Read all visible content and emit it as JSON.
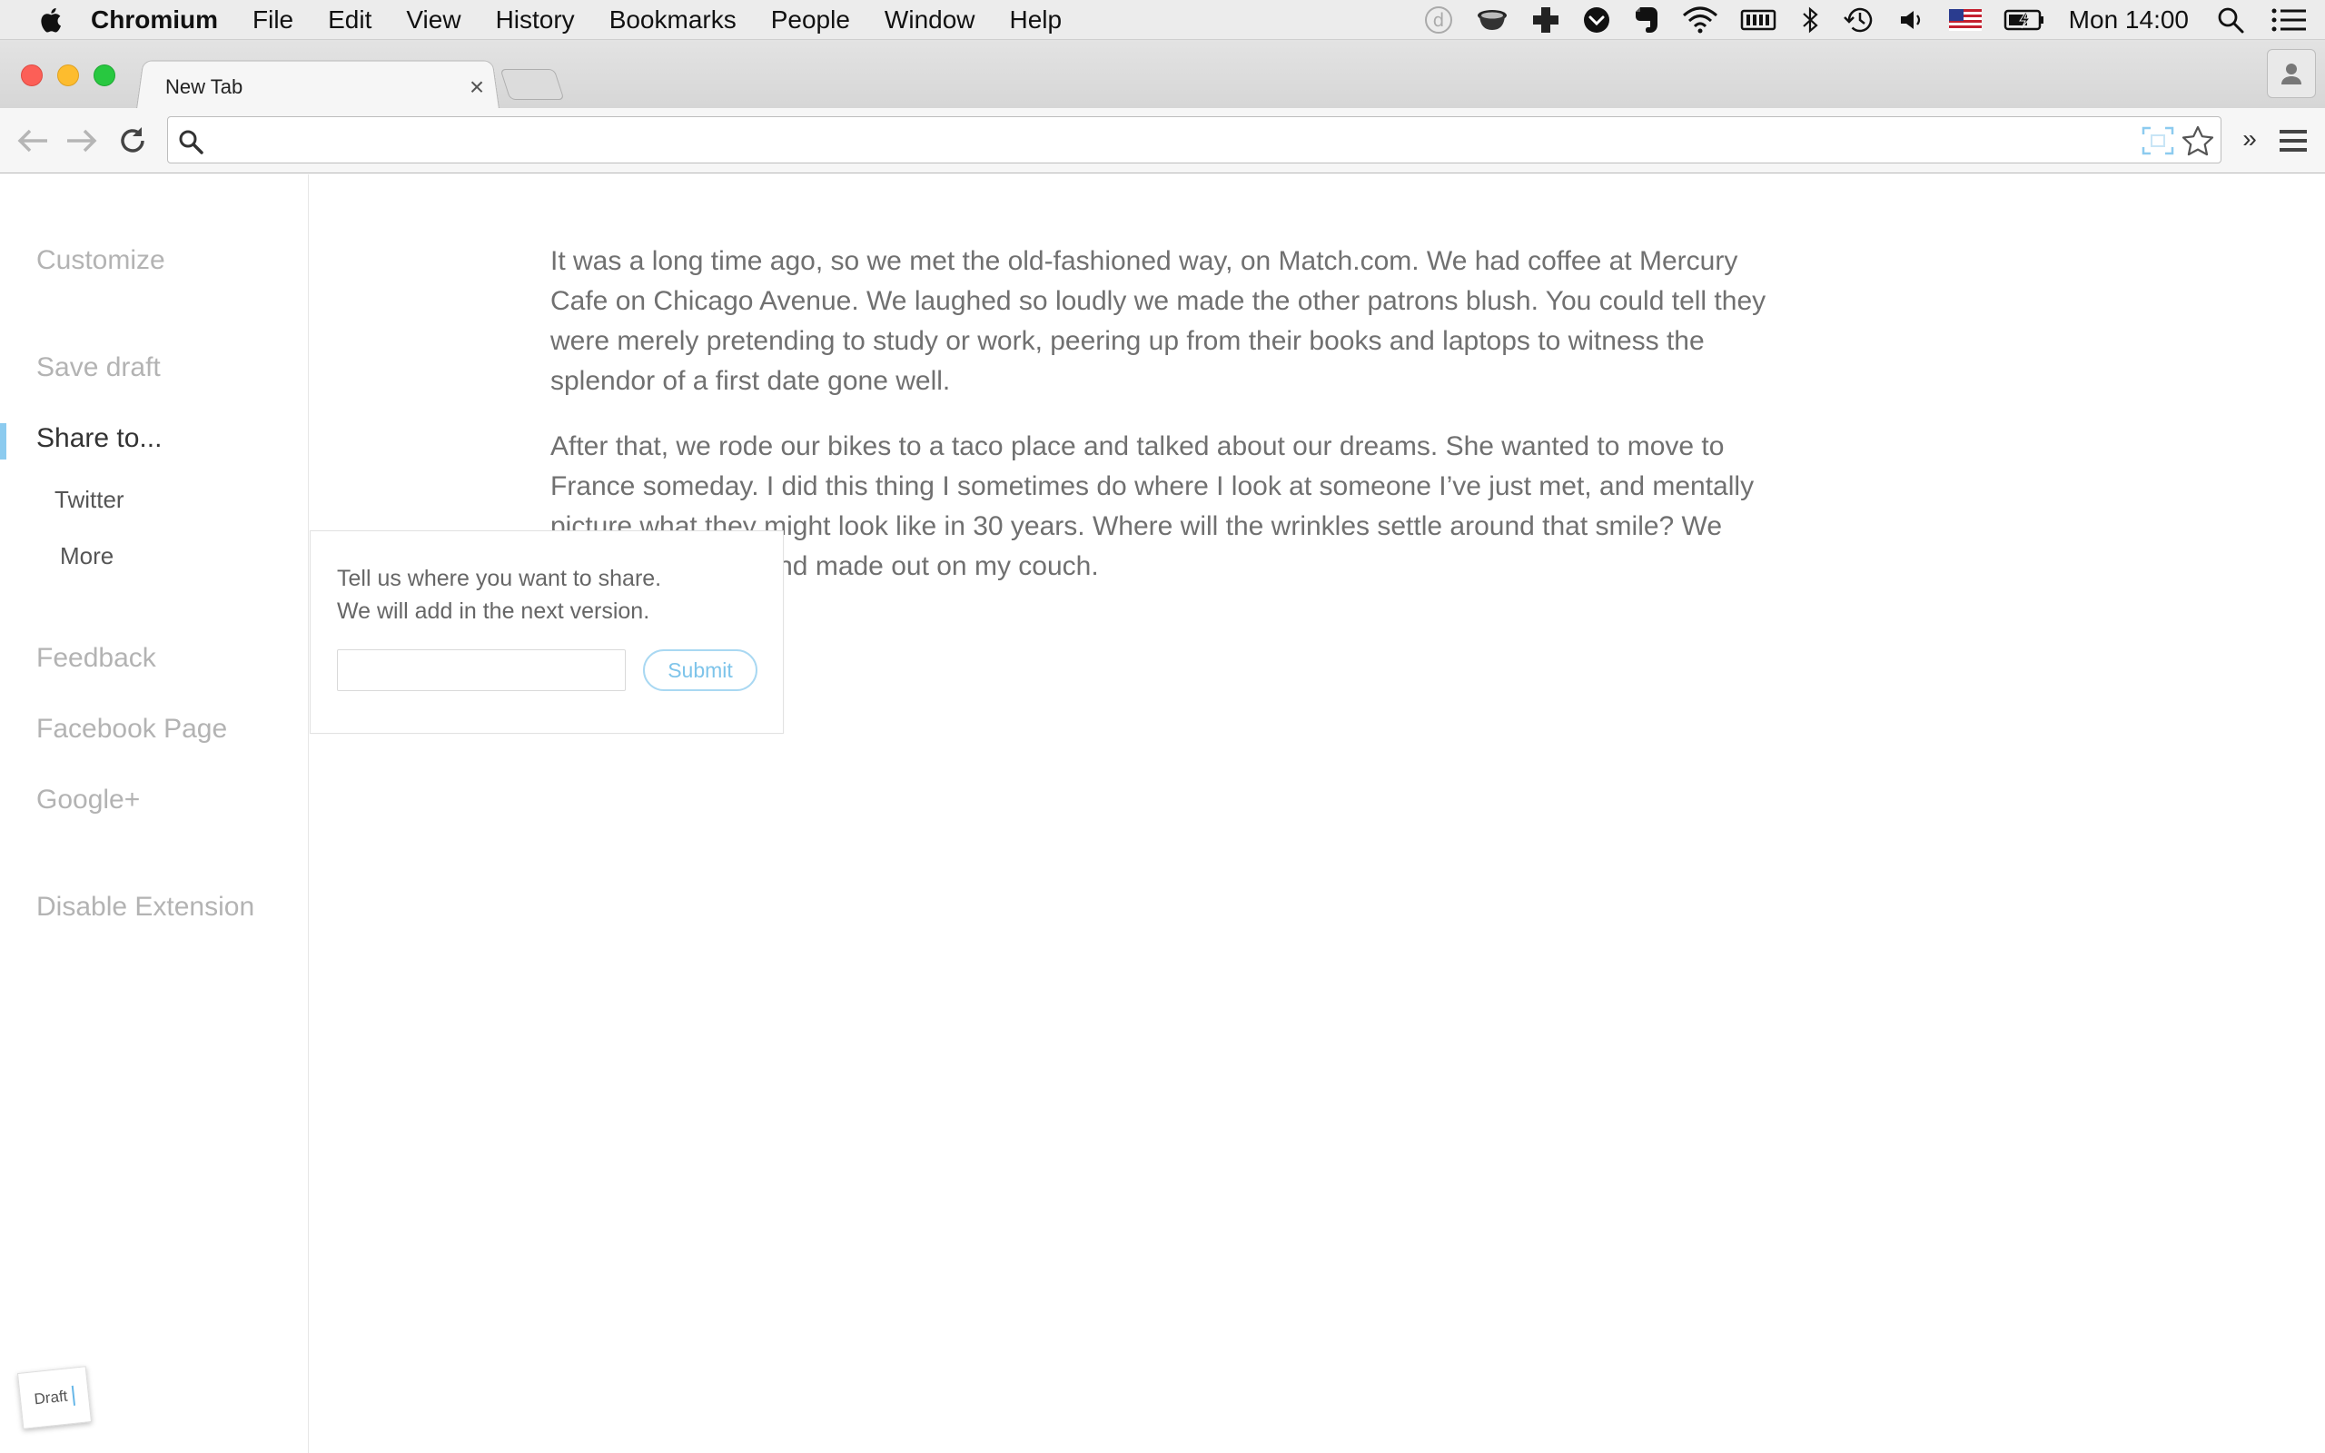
{
  "menubar": {
    "app_name": "Chromium",
    "items": [
      "File",
      "Edit",
      "View",
      "History",
      "Bookmarks",
      "People",
      "Window",
      "Help"
    ],
    "clock": "Mon 14:00",
    "status_icons": [
      "d-icon",
      "coffee-cup-icon",
      "plus-cross-icon",
      "pocket-icon",
      "evernote-icon",
      "wifi-icon",
      "battery-meter-icon",
      "bluetooth-icon",
      "time-machine-icon",
      "volume-icon",
      "us-flag-icon",
      "battery-charging-icon",
      "spotlight-search-icon",
      "notification-list-icon"
    ]
  },
  "browser": {
    "tab_title": "New Tab",
    "tab_close": "×",
    "omnibox_value": "",
    "overflow_label": "»"
  },
  "sidebar": {
    "customize": "Customize",
    "save_draft": "Save draft",
    "share_to": "Share to...",
    "twitter": "Twitter",
    "more": "More",
    "feedback": "Feedback",
    "facebook_page": "Facebook Page",
    "google_plus": "Google+",
    "disable_extension": "Disable Extension",
    "draft_stamp": "Draft"
  },
  "article": {
    "paragraphs": [
      "It was a long time ago, so we met the old-fashioned way, on Match.com. We had coffee at Mercury Cafe on Chicago Avenue. We laughed so loudly we made the other patrons blush. You could tell they were merely pretending to study or work, peering up from their books and laptops to witness the splendor of a first date gone well.",
      "After that, we rode our bikes to a taco place and talked about our dreams. She wanted to move to France someday. I did this thing I sometimes do where I look at someone I’ve just met, and mentally picture what they might look like in 30 years. Where will the wrinkles settle around that smile? We went to my place and made out on my couch."
    ]
  },
  "share_popup": {
    "line1": "Tell us where you want to share.",
    "line2": "We will add in the next version.",
    "input_value": "",
    "submit_label": "Submit"
  },
  "colors": {
    "accent_blue": "#8ccbef",
    "submit_text": "#7ec4ea",
    "muted_text": "#b3b3b3"
  }
}
